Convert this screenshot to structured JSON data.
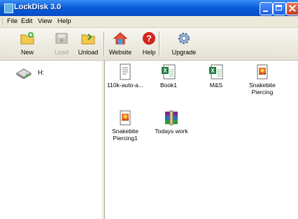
{
  "window": {
    "title": "LockDisk 3.0"
  },
  "menu": {
    "items": [
      {
        "label": "File"
      },
      {
        "label": "Edit"
      },
      {
        "label": "View"
      },
      {
        "label": "Help"
      }
    ]
  },
  "toolbar": {
    "new_label": "New",
    "load_label": "Load",
    "unload_label": "Unload",
    "website_label": "Website",
    "help_label": "Help",
    "upgrade_label": "Upgrade"
  },
  "tree": {
    "drive_label": "H:"
  },
  "files": [
    {
      "name": "110k-auto-a...",
      "icon": "text-document-icon"
    },
    {
      "name": "Book1",
      "icon": "excel-document-icon"
    },
    {
      "name": "M&S",
      "icon": "excel-document-icon"
    },
    {
      "name": "Snakebite Piercing",
      "icon": "image-file-icon"
    },
    {
      "name": "Snakebite Piercing1",
      "icon": "image-file-icon"
    },
    {
      "name": "Todays work",
      "icon": "rar-archive-icon"
    }
  ]
}
